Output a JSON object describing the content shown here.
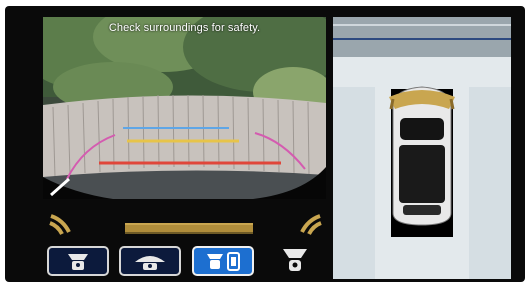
{
  "rear_camera": {
    "safety_message": "Check surroundings for safety."
  },
  "colors": {
    "guide_red": "#e0463a",
    "guide_yellow": "#e7c44a",
    "guide_green": "#35c46b",
    "guide_blue": "#5fa6e6",
    "guide_pink": "#d45bb0",
    "sensor_amber": "#b08d3b",
    "selected_button": "#1d6fd0",
    "button_bg": "#0c1a3c"
  },
  "buttons": [
    {
      "icon": "rear-camera-normal-view-icon",
      "selected": false
    },
    {
      "icon": "rear-camera-wide-view-icon",
      "selected": false
    },
    {
      "icon": "split-view-icon",
      "selected": true
    }
  ],
  "indicators": {
    "front_camera_icon": "front-camera-icon",
    "left_sensor_icon": "parking-sensor-left-icon",
    "right_sensor_icon": "parking-sensor-right-icon"
  }
}
